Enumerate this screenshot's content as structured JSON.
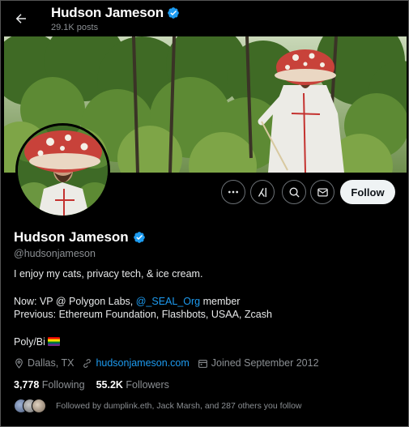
{
  "header": {
    "display_name": "Hudson Jameson",
    "post_count": "29.1K posts"
  },
  "profile": {
    "display_name": "Hudson Jameson",
    "handle": "@hudsonjameson",
    "bio_line1": "I enjoy my cats, privacy tech, & ice cream.",
    "bio_line2_prefix": "Now: VP @ Polygon Labs, ",
    "bio_line2_link": "@_SEAL_Org",
    "bio_line2_suffix": " member",
    "bio_line3": "Previous: Ethereum Foundation, Flashbots, USAA, Zcash",
    "bio_line4": "Poly/Bi",
    "location": "Dallas, TX",
    "website": "hudsonjameson.com",
    "joined": "Joined September 2012"
  },
  "stats": {
    "following_count": "3,778",
    "following_label": "Following",
    "followers_count": "55.2K",
    "followers_label": "Followers"
  },
  "followed_by": "Followed by dumplink.eth, Jack Marsh, and 287 others you follow",
  "buttons": {
    "follow": "Follow"
  },
  "colors": {
    "accent": "#1d9bf0",
    "background": "#000000",
    "follow_button": "#eff3f4"
  },
  "icons": [
    "back-arrow-icon",
    "verified-badge-icon",
    "more-icon",
    "grok-icon",
    "search-icon",
    "message-icon",
    "location-icon",
    "link-icon",
    "calendar-icon"
  ]
}
